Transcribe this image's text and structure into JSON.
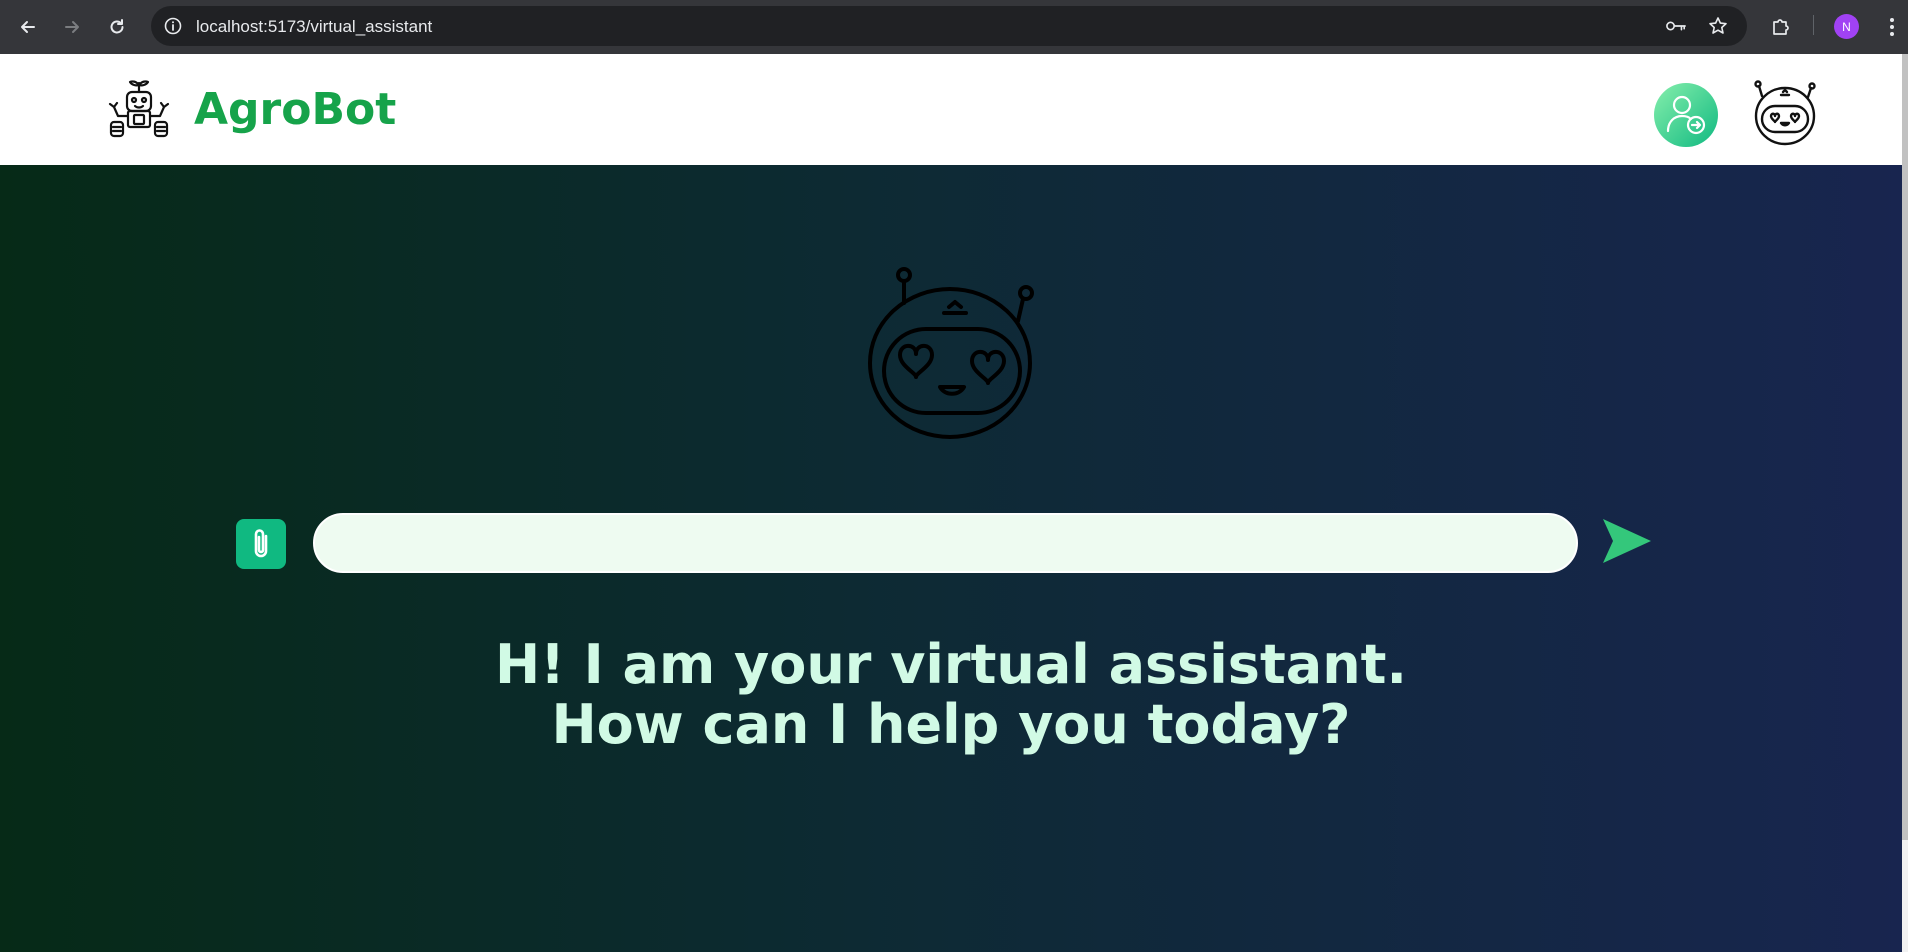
{
  "browser": {
    "url": "localhost:5173/virtual_assistant",
    "profile_initial": "N",
    "profile_color": "#a142f4"
  },
  "header": {
    "brand_name": "AgroBot",
    "brand_color": "#16a34a",
    "logo_icon": "farm-robot-icon",
    "login_icon": "user-login-icon",
    "avatar_icon": "robot-face-icon"
  },
  "hero": {
    "bot_icon": "robot-face-heart-eyes-icon",
    "attach_icon": "paperclip-icon",
    "send_icon": "send-arrow-icon",
    "input_value": "",
    "input_placeholder": "",
    "greeting_line1": "H! I am your virtual assistant.",
    "greeting_line2": "How can I help you today?",
    "accent_color": "#10b981",
    "text_color": "#d1fae5"
  }
}
